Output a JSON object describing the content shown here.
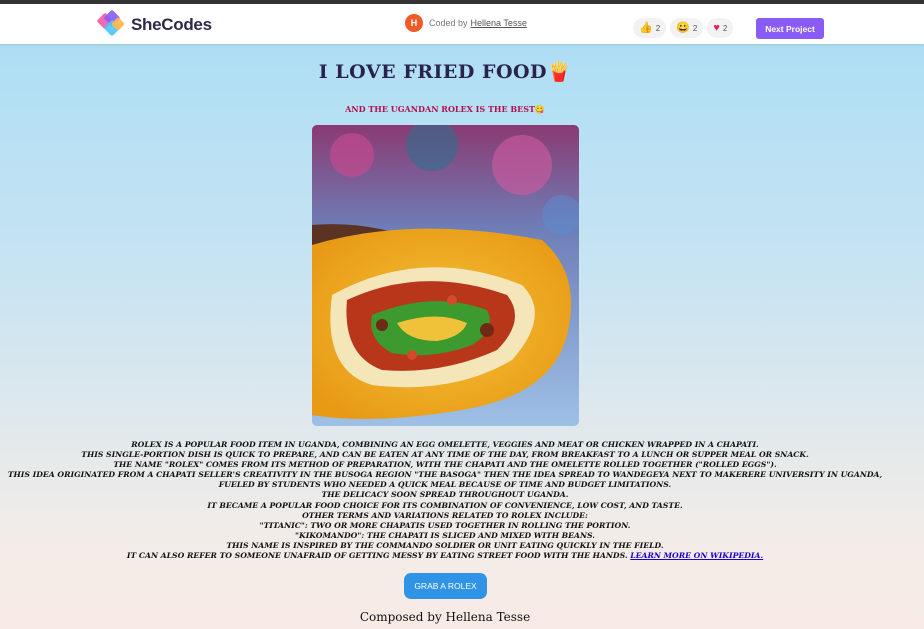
{
  "header": {
    "logo_text": "SheCodes",
    "avatar_initial": "H",
    "coded_by_label": "Coded by",
    "coded_by_name": "Hellena Tesse",
    "reactions": [
      {
        "icon": "thumbs-up-icon",
        "count": "2"
      },
      {
        "icon": "grinning-face-icon",
        "count": "2"
      },
      {
        "icon": "heart-icon",
        "count": "2"
      }
    ],
    "next_project_label": "Next Project",
    "accent_color": "#8a5cf6"
  },
  "main": {
    "title": "I LOVE FRIED FOOD🍟",
    "subtitle": "And the Ugandan rolex is the best😋",
    "image_icon": "rolex-photo",
    "paragraph_lines": [
      "Rolex is a popular food item in Uganda, combining an egg omelette, veggies and meat or chicken wrapped in a chapati.",
      "This single-portion dish is quick to prepare, and can be eaten at any time of the day, from breakfast to a lunch or supper meal or snack.",
      "The name \"Rolex\" comes from its method of preparation, with the chapati and the omelette rolled together (\"rolled eggs\").",
      "This idea originated from a chapati seller's creativity in the Busoga region \"the Basoga\" then the idea spread to Wandegeya next to Makerere University in Uganda,",
      "fueled by students who needed a quick meal because of time and budget limitations.",
      "The delicacy soon spread throughout Uganda.",
      "It became a popular food choice for its combination of convenience, low cost, and taste.",
      "Other terms and variations related to Rolex include:",
      "\"Titanic\": Two or more chapatis used together in rolling the portion.",
      "\"Kikomando\": The chapati is sliced and mixed with beans.",
      "This name is inspired by the commando soldier or unit eating quickly in the field.",
      "It can also refer to someone unafraid of getting messy by eating street food with the hands."
    ],
    "learn_more_label": "Learn more on Wikipedia.",
    "grab_button_label": "GRAB A ROLEX",
    "composed_by": "Composed by Hellena Tesse"
  }
}
